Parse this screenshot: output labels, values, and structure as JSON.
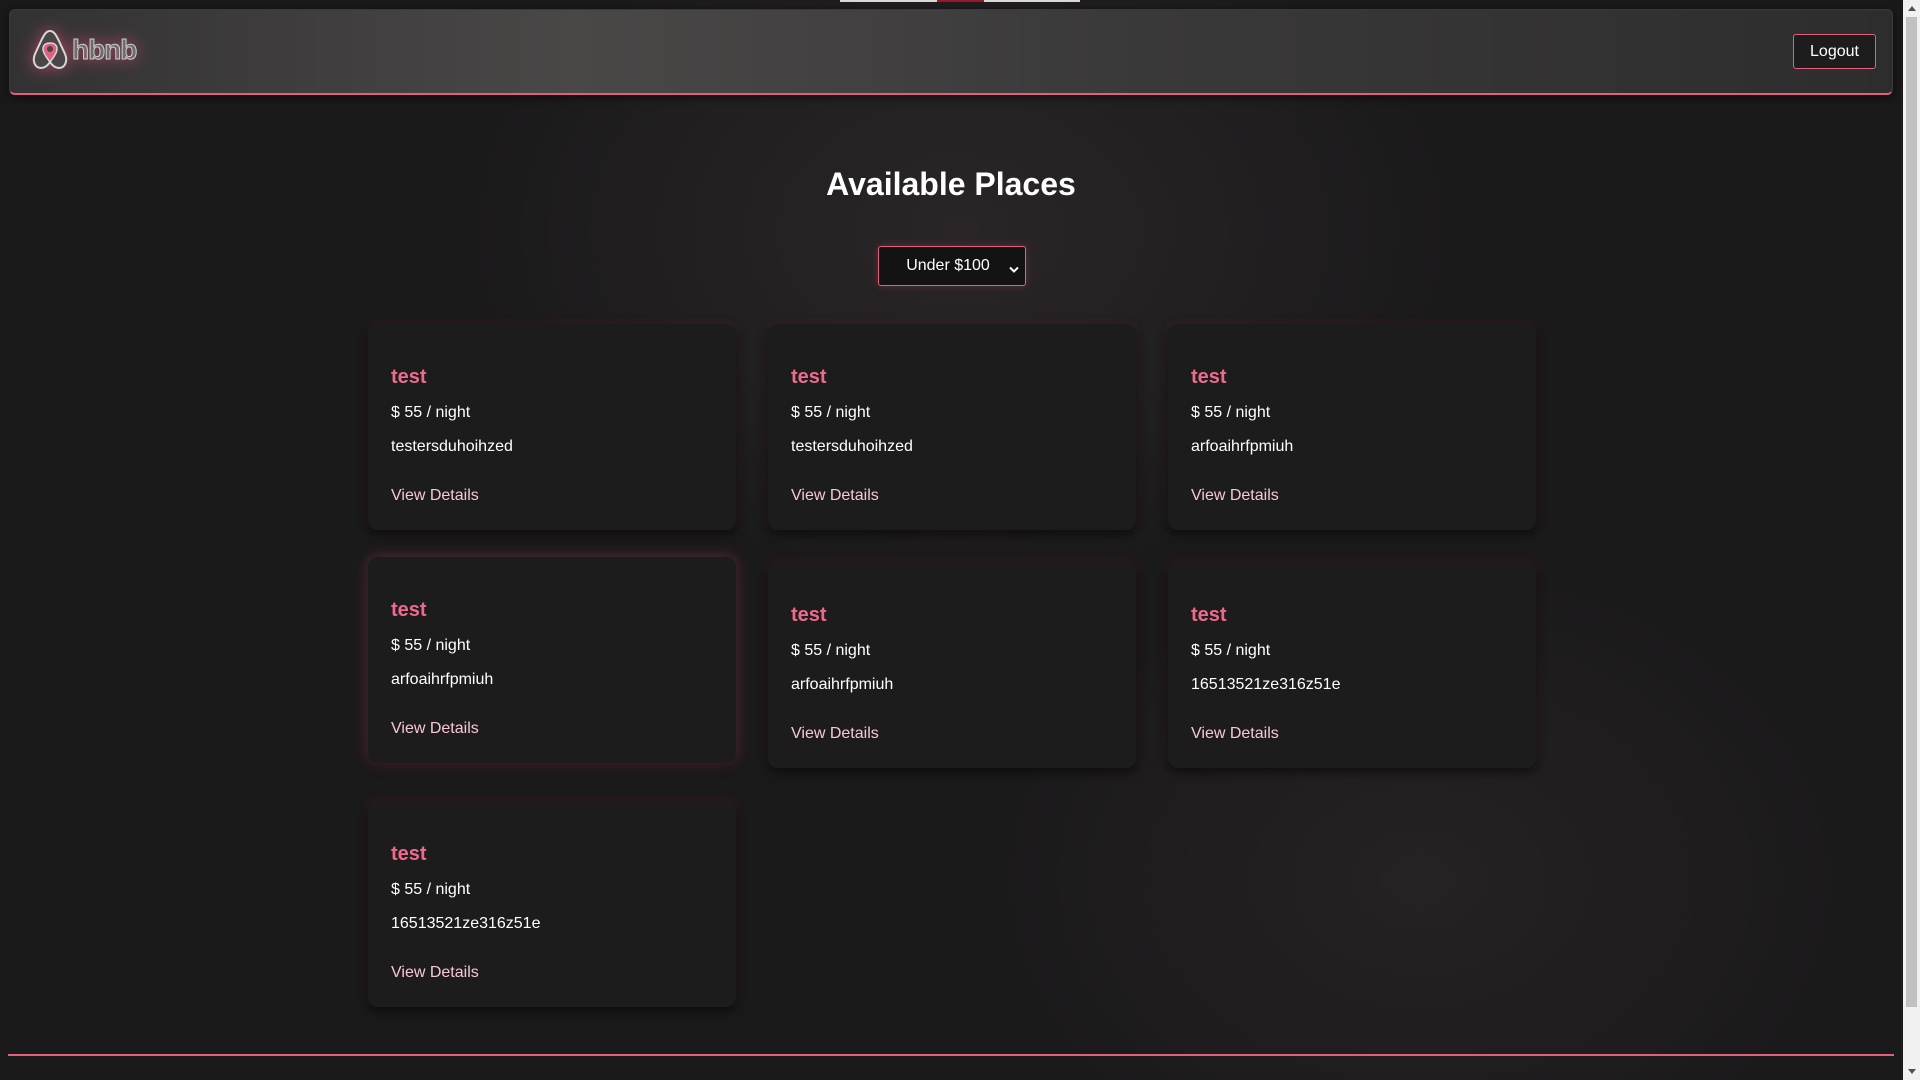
{
  "header": {
    "logo_text": "hbnb",
    "logout_label": "Logout"
  },
  "main": {
    "title": "Available Places",
    "price_filter": {
      "selected": "Under $100"
    },
    "places": [
      {
        "title": "test",
        "price": "$ 55 / night",
        "description": "testersduhoihzed",
        "link": "View Details"
      },
      {
        "title": "test",
        "price": "$ 55 / night",
        "description": "testersduhoihzed",
        "link": "View Details"
      },
      {
        "title": "test",
        "price": "$ 55 / night",
        "description": "arfoaihrfpmiuh",
        "link": "View Details"
      },
      {
        "title": "test",
        "price": "$ 55 / night",
        "description": "arfoaihrfpmiuh",
        "link": "View Details"
      },
      {
        "title": "test",
        "price": "$ 55 / night",
        "description": "arfoaihrfpmiuh",
        "link": "View Details"
      },
      {
        "title": "test",
        "price": "$ 55 / night",
        "description": "16513521ze316z51e",
        "link": "View Details"
      },
      {
        "title": "test",
        "price": "$ 55 / night",
        "description": "16513521ze316z51e",
        "link": "View Details"
      }
    ]
  },
  "colors": {
    "accent": "#e0607e",
    "card_title": "#ee6a8b",
    "link": "#f7c7d3",
    "background": "#1b1a1b"
  },
  "icons": {
    "logo": "airbnb-logo-icon",
    "select_arrow": "chevron-down-icon"
  }
}
